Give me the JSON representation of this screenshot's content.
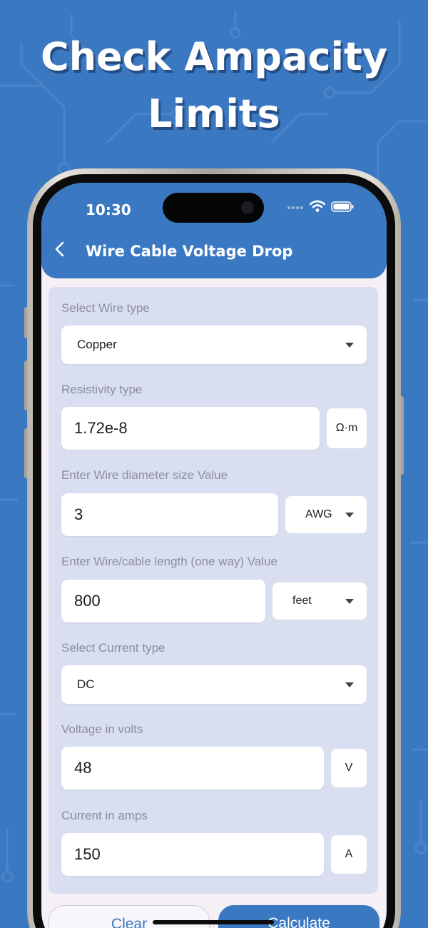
{
  "promo": {
    "headline_line1": "Check Ampacity",
    "headline_line2": "Limits"
  },
  "status_bar": {
    "time": "10:30"
  },
  "header": {
    "title": "Wire Cable Voltage Drop",
    "back_icon": "chevron-left-icon"
  },
  "form": {
    "wire_type": {
      "label": "Select Wire type",
      "value": "Copper"
    },
    "resistivity": {
      "label": "Resistivity type",
      "value": "1.72e-8",
      "unit": "Ω·m"
    },
    "diameter": {
      "label": "Enter Wire diameter size Value",
      "value": "3",
      "unit": "AWG"
    },
    "length": {
      "label": "Enter Wire/cable length (one way) Value",
      "value": "800",
      "unit": "feet"
    },
    "current_type": {
      "label": "Select Current  type",
      "value": "DC"
    },
    "voltage": {
      "label": "Voltage in volts",
      "value": "48",
      "unit": "V"
    },
    "current": {
      "label": "Current in amps",
      "value": "150",
      "unit": "A"
    }
  },
  "actions": {
    "clear_label": "Clear",
    "calculate_label": "Calculate"
  },
  "colors": {
    "brand": "#3a78c2",
    "card": "#d9def0",
    "screen_bg": "#f4f0f6"
  }
}
